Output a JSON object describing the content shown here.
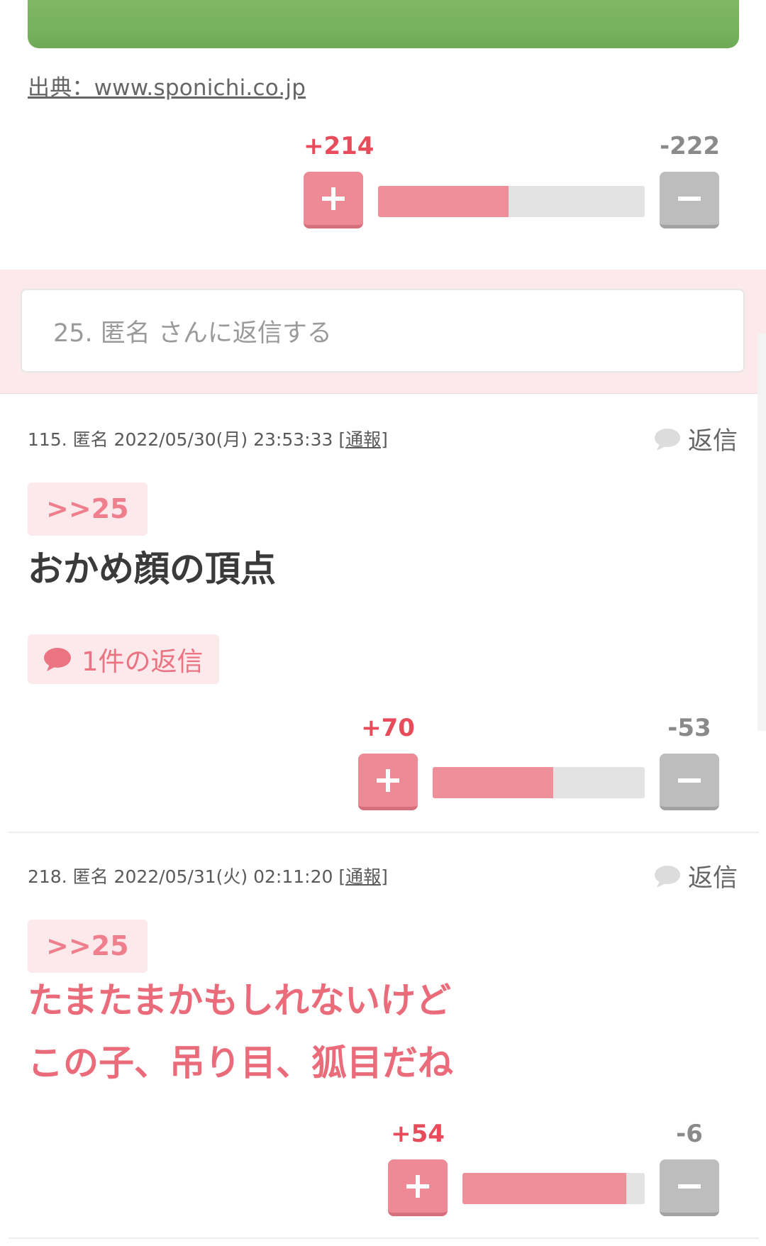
{
  "source_link": "出典：www.sponichi.co.jp",
  "post_vote": {
    "plus": "+214",
    "minus": "-222",
    "ratio": 0.49
  },
  "reply_box": {
    "placeholder": "25. 匿名 さんに返信する"
  },
  "comments": [
    {
      "meta": "115. 匿名 2022/05/30(月) 23:53:33",
      "report": "[通報]",
      "reply_label": "返信",
      "anchor": ">>25",
      "body_lines": [
        "おかめ顔の頂点"
      ],
      "replies_chip": "1件の返信",
      "vote": {
        "plus": "+70",
        "minus": "-53",
        "ratio": 0.57
      }
    },
    {
      "meta": "218. 匿名 2022/05/31(火) 02:11:20",
      "report": "[通報]",
      "reply_label": "返信",
      "anchor": ">>25",
      "body_lines": [
        "たまたまかもしれないけど",
        "この子、吊り目、狐目だね"
      ],
      "vote": {
        "plus": "+54",
        "minus": "-6",
        "ratio": 0.9
      }
    }
  ],
  "colors": {
    "accent": "#ee8a96",
    "accent_text": "#ea6b79",
    "plus_count": "#e84b5a",
    "minus": "#bdbdbd",
    "pink_bg": "#fbe9ec"
  }
}
